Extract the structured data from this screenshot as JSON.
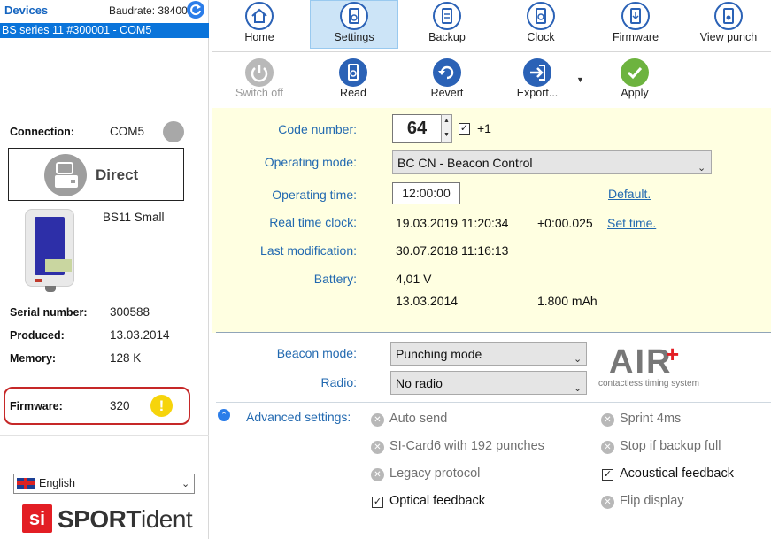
{
  "devices": {
    "title": "Devices",
    "baudrate": "Baudrate: 38400",
    "selected": "BS series 11 #300001 - COM5"
  },
  "connection": {
    "label": "Connection:",
    "value": "COM5",
    "mode": "Direct"
  },
  "device": {
    "model": "BS11 Small",
    "serial_label": "Serial number:",
    "serial": "300588",
    "produced_label": "Produced:",
    "produced": "13.03.2014",
    "memory_label": "Memory:",
    "memory": "128 K",
    "firmware_label": "Firmware:",
    "firmware": "320",
    "warning_glyph": "!"
  },
  "language": {
    "selected": "English"
  },
  "brand": {
    "si": "si",
    "name_bold": "SPORT",
    "name_rest": "ident"
  },
  "nav": [
    {
      "label": "Home",
      "icon": "home-icon"
    },
    {
      "label": "Settings",
      "icon": "settings-icon",
      "selected": true
    },
    {
      "label": "Backup",
      "icon": "backup-icon"
    },
    {
      "label": "Clock",
      "icon": "clock-icon"
    },
    {
      "label": "Firmware",
      "icon": "firmware-icon"
    },
    {
      "label": "View punch",
      "icon": "view-punch-icon"
    }
  ],
  "actions": [
    {
      "label": "Switch off",
      "icon": "power-icon",
      "disabled": true
    },
    {
      "label": "Read",
      "icon": "read-icon"
    },
    {
      "label": "Revert",
      "icon": "revert-icon"
    },
    {
      "label": "Export...",
      "icon": "export-icon"
    },
    {
      "label": "Apply",
      "icon": "apply-icon"
    }
  ],
  "form": {
    "code_number_label": "Code number:",
    "code_number": "64",
    "plus_one": "+1",
    "operating_mode_label": "Operating mode:",
    "operating_mode": "BC CN - Beacon Control",
    "operating_time_label": "Operating time:",
    "operating_time": "12:00:00",
    "default_link": "Default.",
    "rtc_label": "Real time clock:",
    "rtc": "19.03.2019 11:20:34",
    "rtc_offset": "+0:00.025",
    "set_time_link": "Set time.",
    "last_mod_label": "Last modification:",
    "last_mod": "30.07.2018 11:16:13",
    "battery_label": "Battery:",
    "battery_voltage": "4,01 V",
    "battery_date": "13.03.2014",
    "battery_capacity": "1.800 mAh"
  },
  "beacon": {
    "mode_label": "Beacon mode:",
    "mode": "Punching mode",
    "radio_label": "Radio:",
    "radio": "No radio",
    "logo": "AIR",
    "logo_plus": "+",
    "logo_sub": "contactless timing system"
  },
  "advanced": {
    "label": "Advanced settings:",
    "options_left": [
      {
        "label": "Auto send",
        "checked": false
      },
      {
        "label": "SI-Card6 with 192 punches",
        "checked": false
      },
      {
        "label": "Legacy protocol",
        "checked": false
      },
      {
        "label": "Optical feedback",
        "checked": true
      }
    ],
    "options_right": [
      {
        "label": "Sprint 4ms",
        "checked": false
      },
      {
        "label": "Stop if backup full",
        "checked": false
      },
      {
        "label": "Acoustical feedback",
        "checked": true
      },
      {
        "label": "Flip display",
        "checked": false
      }
    ]
  },
  "colors": {
    "accent": "#0a74da",
    "link": "#2269b0",
    "apply": "#6db33f",
    "warning": "#f6d40c",
    "brand_red": "#e31e24"
  }
}
